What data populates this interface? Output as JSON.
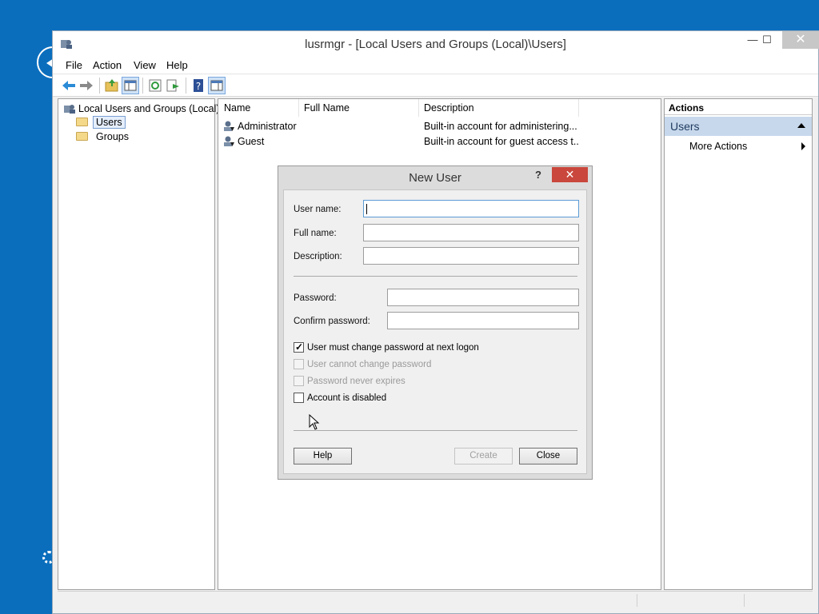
{
  "window": {
    "title": "lusrmgr - [Local Users and Groups (Local)\\Users]",
    "controls": {
      "minimize": "—",
      "maximize": "☐",
      "close": "✕"
    }
  },
  "menu": {
    "items": [
      "File",
      "Action",
      "View",
      "Help"
    ]
  },
  "toolbar": {
    "icons": [
      "back-arrow-icon",
      "forward-arrow-icon",
      "up-folder-icon",
      "show-hide-tree-icon",
      "refresh-icon",
      "export-list-icon",
      "help-icon",
      "show-hide-action-pane-icon"
    ]
  },
  "tree": {
    "root": "Local Users and Groups (Local)",
    "items": [
      "Users",
      "Groups"
    ],
    "selected": "Users"
  },
  "list": {
    "columns": [
      "Name",
      "Full Name",
      "Description"
    ],
    "rows": [
      {
        "name": "Administrator",
        "full_name": "",
        "description": "Built-in account for administering..."
      },
      {
        "name": "Guest",
        "full_name": "",
        "description": "Built-in account for guest access t..."
      }
    ]
  },
  "actions": {
    "header": "Actions",
    "section": "Users",
    "items": [
      "More Actions"
    ]
  },
  "dialog": {
    "title": "New User",
    "help_glyph": "?",
    "close_glyph": "✕",
    "labels": {
      "user_name": "User name:",
      "full_name": "Full name:",
      "description": "Description:",
      "password": "Password:",
      "confirm_password": "Confirm password:"
    },
    "values": {
      "user_name": "",
      "full_name": "",
      "description": "",
      "password": "",
      "confirm_password": ""
    },
    "checkboxes": [
      {
        "label": "User must change password at next logon",
        "checked": true,
        "enabled": true
      },
      {
        "label": "User cannot change password",
        "checked": false,
        "enabled": false
      },
      {
        "label": "Password never expires",
        "checked": false,
        "enabled": false
      },
      {
        "label": "Account is disabled",
        "checked": false,
        "enabled": true
      }
    ],
    "buttons": {
      "help": "Help",
      "create": "Create",
      "close": "Close"
    }
  },
  "colors": {
    "desktop": "#0a6ebd",
    "dialog_close": "#c9473c",
    "actions_section": "#c7d8ec"
  }
}
